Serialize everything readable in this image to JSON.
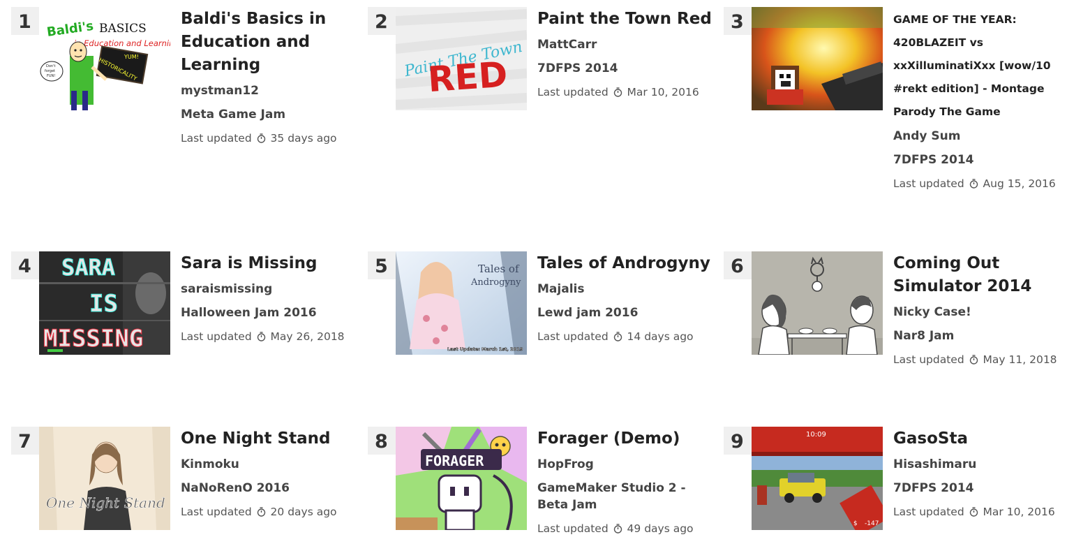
{
  "updated_label": "Last updated",
  "games": [
    {
      "rank": "1",
      "title": "Baldi's Basics in Education and Learning",
      "author": "mystman12",
      "jam": "Meta Game Jam",
      "updated": "35 days ago"
    },
    {
      "rank": "2",
      "title": "Paint the Town Red",
      "author": "MattCarr",
      "jam": "7DFPS 2014",
      "updated": "Mar 10, 2016"
    },
    {
      "rank": "3",
      "title": "GAME OF THE YEAR: 420BLAZEIT vs xxXilluminatiXxx [wow/10 #rekt edition] - Montage Parody The Game",
      "author": "Andy Sum",
      "jam": "7DFPS 2014",
      "updated": "Aug 15, 2016"
    },
    {
      "rank": "4",
      "title": "Sara is Missing",
      "author": "saraismissing",
      "jam": "Halloween Jam 2016",
      "updated": "May 26, 2018"
    },
    {
      "rank": "5",
      "title": "Tales of Androgyny",
      "author": "Majalis",
      "jam": "Lewd jam 2016",
      "updated": "14 days ago"
    },
    {
      "rank": "6",
      "title": "Coming Out Simulator 2014",
      "author": "Nicky Case!",
      "jam": "Nar8 Jam",
      "updated": "May 11, 2018"
    },
    {
      "rank": "7",
      "title": "One Night Stand",
      "author": "Kinmoku",
      "jam": "NaNoRenO 2016",
      "updated": "20 days ago"
    },
    {
      "rank": "8",
      "title": "Forager (Demo)",
      "author": "HopFrog",
      "jam": "GameMaker Studio 2 - Beta Jam",
      "updated": "49 days ago"
    },
    {
      "rank": "9",
      "title": "GasoSta",
      "author": "Hisashimaru",
      "jam": "7DFPS 2014",
      "updated": "Mar 10, 2016"
    }
  ],
  "thumbnails": {
    "baldi": {
      "line1": "Baldi's",
      "line2": "BASICS",
      "line3": "in Education and Learning",
      "board": "HISTORICALITY",
      "yum": "YUM!",
      "bubble1": "Don't",
      "bubble2": "forget",
      "bubble3": "FUN!"
    },
    "ptr": {
      "script": "Paint The Town",
      "big": "RED"
    },
    "sara": {
      "l1": "SARA",
      "l2": "IS",
      "l3": "MISSING"
    },
    "tales": {
      "t1": "Tales of",
      "t2": "Androgyny",
      "update": "Last Update: March 1st, 2019"
    },
    "ons": {
      "text": "One Night Stand"
    },
    "forager": {
      "text": "FORAGER"
    },
    "gasosta": {
      "time": "10:09",
      "money": "$",
      "value": "-147"
    }
  },
  "colors": {
    "accent_red": "#d62020",
    "rank_bg": "#f0f0f0"
  }
}
